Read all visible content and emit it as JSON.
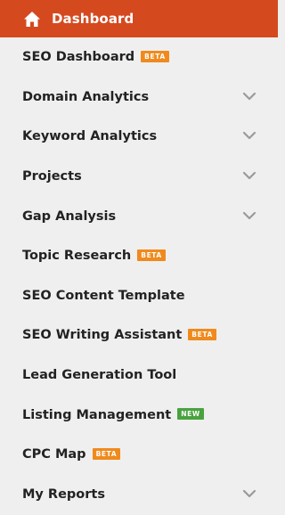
{
  "active": {
    "label": "Dashboard",
    "icon": "home-icon",
    "background": "#d5491f"
  },
  "items": [
    {
      "id": "seo-dashboard",
      "label": "SEO Dashboard",
      "badge": "BETA",
      "badge_type": "beta",
      "expandable": false
    },
    {
      "id": "domain-analytics",
      "label": "Domain Analytics",
      "badge": null,
      "expandable": true
    },
    {
      "id": "keyword-analytics",
      "label": "Keyword Analytics",
      "badge": null,
      "expandable": true
    },
    {
      "id": "projects",
      "label": "Projects",
      "badge": null,
      "expandable": true
    },
    {
      "id": "gap-analysis",
      "label": "Gap Analysis",
      "badge": null,
      "expandable": true
    },
    {
      "id": "topic-research",
      "label": "Topic Research",
      "badge": "BETA",
      "badge_type": "beta",
      "expandable": false
    },
    {
      "id": "seo-content-template",
      "label": "SEO Content Template",
      "badge": null,
      "expandable": false
    },
    {
      "id": "seo-writing-assistant",
      "label": "SEO Writing Assistant",
      "badge": "BETA",
      "badge_type": "beta",
      "expandable": false
    },
    {
      "id": "lead-generation-tool",
      "label": "Lead Generation Tool",
      "badge": null,
      "expandable": false
    },
    {
      "id": "listing-management",
      "label": "Listing Management",
      "badge": "NEW",
      "badge_type": "new",
      "expandable": false
    },
    {
      "id": "cpc-map",
      "label": "CPC Map",
      "badge": "BETA",
      "badge_type": "beta",
      "expandable": false
    },
    {
      "id": "my-reports",
      "label": "My Reports",
      "badge": null,
      "expandable": true
    }
  ],
  "colors": {
    "beta_badge": "#f08a1d",
    "new_badge": "#4aa23f",
    "chevron": "#9a9a9a",
    "text": "#222222",
    "background": "#efefef"
  }
}
